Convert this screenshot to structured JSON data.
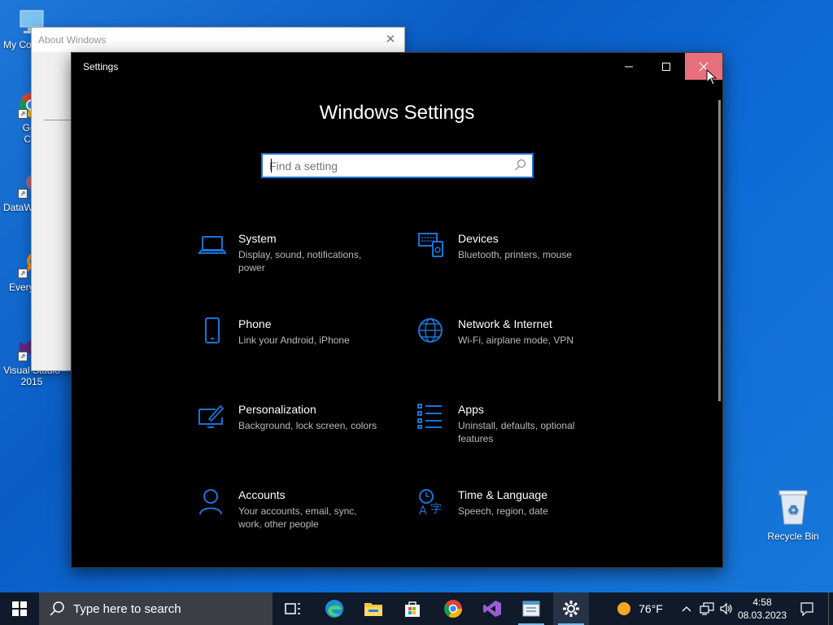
{
  "desktop": {
    "icons": [
      {
        "label": "My Co",
        "icon": "computer-icon"
      },
      {
        "label": "Goo Chr",
        "icon": "chrome-icon"
      },
      {
        "label": "DataW",
        "icon": "datawrapper-icon"
      },
      {
        "label": "Every",
        "icon": "everything-icon"
      },
      {
        "label": "Visual Studio 2015",
        "icon": "visual-studio-icon"
      }
    ],
    "recycle_bin": "Recycle Bin"
  },
  "about_window": {
    "title": "About Windows",
    "close": "✕"
  },
  "settings": {
    "window_title": "Settings",
    "heading": "Windows Settings",
    "search_placeholder": "Find a setting",
    "categories": [
      {
        "title": "System",
        "desc": "Display, sound, notifications, power",
        "icon": "laptop-icon"
      },
      {
        "title": "Devices",
        "desc": "Bluetooth, printers, mouse",
        "icon": "devices-icon"
      },
      {
        "title": "Phone",
        "desc": "Link your Android, iPhone",
        "icon": "phone-icon"
      },
      {
        "title": "Network & Internet",
        "desc": "Wi-Fi, airplane mode, VPN",
        "icon": "globe-icon"
      },
      {
        "title": "Personalization",
        "desc": "Background, lock screen, colors",
        "icon": "personalization-icon"
      },
      {
        "title": "Apps",
        "desc": "Uninstall, defaults, optional features",
        "icon": "apps-list-icon"
      },
      {
        "title": "Accounts",
        "desc": "Your accounts, email, sync, work, other people",
        "icon": "person-icon"
      },
      {
        "title": "Time & Language",
        "desc": "Speech, region, date",
        "icon": "time-language-icon"
      }
    ]
  },
  "taskbar": {
    "search_placeholder": "Type here to search",
    "weather_temp": "76°F",
    "time": "4:58",
    "date": "08.03.2023",
    "apps": [
      "task-view-icon",
      "edge-icon",
      "file-explorer-icon",
      "store-icon",
      "chrome-icon",
      "visual-studio-icon",
      "notepad-icon",
      "settings-gear-icon"
    ]
  },
  "colors": {
    "accent": "#1a73d8",
    "close_hover": "#e8707c",
    "settings_bg": "#000000",
    "taskbar_bg": "#101a2a"
  }
}
